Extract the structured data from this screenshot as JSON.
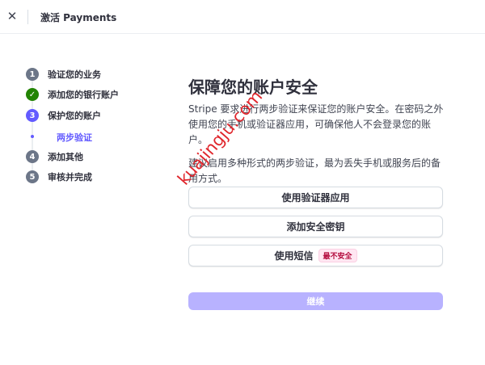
{
  "header": {
    "close_icon": "close-icon",
    "title": "激活 Payments"
  },
  "stepper": {
    "steps": [
      {
        "number": "1",
        "label": "验证您的业务",
        "state": "pending"
      },
      {
        "number": "✓",
        "label": "添加您的银行账户",
        "state": "done"
      },
      {
        "number": "3",
        "label": "保护您的账户",
        "state": "active"
      },
      {
        "number": "4",
        "label": "添加其他",
        "state": "pending"
      },
      {
        "number": "5",
        "label": "审核并完成",
        "state": "pending"
      }
    ],
    "substep": {
      "label": "两步验证"
    }
  },
  "main": {
    "heading": "保障您的账户安全",
    "paragraph1": "Stripe 要求进行两步验证来保证您的账户安全。在密码之外使用您的手机或验证器应用，可确保他人不会登录您的账户。",
    "paragraph2": "建议启用多种形式的两步验证，最为丢失手机或服务后的备用方式。",
    "options": [
      {
        "label": "使用验证器应用"
      },
      {
        "label": "添加安全密钥"
      },
      {
        "label": "使用短信",
        "badge": "最不安全"
      }
    ],
    "continue_label": "继续"
  },
  "watermark": "kuajingju.com",
  "colors": {
    "accent": "#635bff",
    "done": "#228403",
    "disabled_button": "#b8b2ff",
    "badge_text": "#b3093c",
    "watermark": "#e0262c"
  }
}
